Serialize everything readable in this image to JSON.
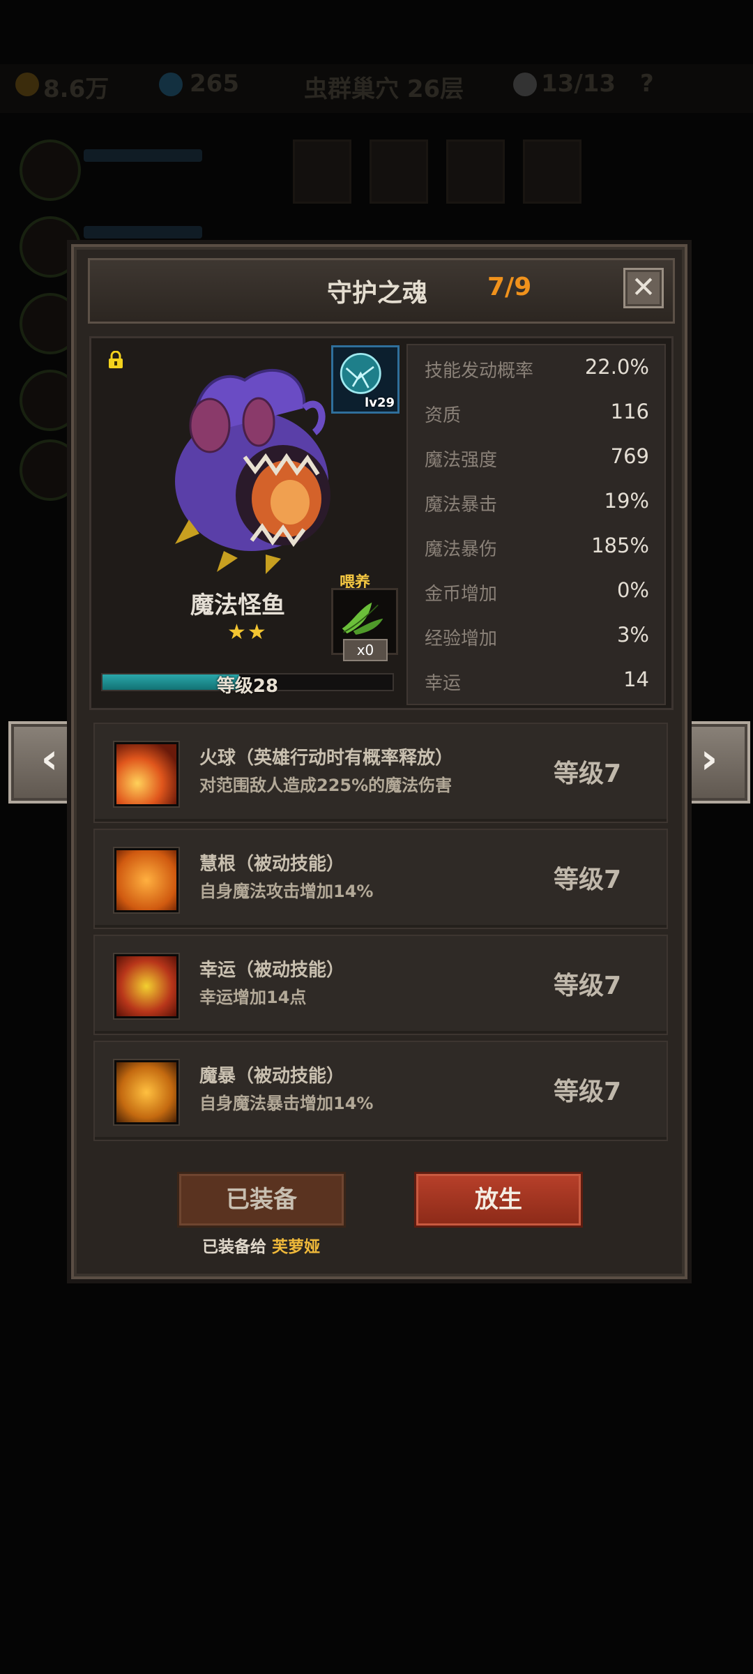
{
  "hud": {
    "gold": "8.6万",
    "gems": "265",
    "stage": "虫群巢穴 26层",
    "kills": "13/13",
    "help": "?"
  },
  "dialog": {
    "title": "守护之魂",
    "count": "7/9",
    "close": "✕"
  },
  "pet": {
    "name": "魔法怪鱼",
    "stars": "★★",
    "star_count": 2,
    "gem_level": "lv29",
    "feed_label": "喂养",
    "feed_count": "x0",
    "level_text": "等级28",
    "level_progress": 0.47
  },
  "stats": [
    {
      "label": "技能发动概率",
      "value": "22.0%"
    },
    {
      "label": "资质",
      "value": "116"
    },
    {
      "label": "魔法强度",
      "value": "769"
    },
    {
      "label": "魔法暴击",
      "value": "19%"
    },
    {
      "label": "魔法暴伤",
      "value": "185%"
    },
    {
      "label": "金币增加",
      "value": "0%"
    },
    {
      "label": "经验增加",
      "value": "3%"
    },
    {
      "label": "幸运",
      "value": "14"
    }
  ],
  "skills": [
    {
      "name": "火球（英雄行动时有概率释放）",
      "desc": "对范围敌人造成225%的魔法伤害",
      "level": "等级7",
      "icon": "fireball-icon"
    },
    {
      "name": "慧根（被动技能）",
      "desc": "自身魔法攻击增加14%",
      "level": "等级7",
      "icon": "demon-icon"
    },
    {
      "name": "幸运（被动技能）",
      "desc": "幸运增加14点",
      "level": "等级7",
      "icon": "puzzle-icon"
    },
    {
      "name": "魔暴（被动技能）",
      "desc": "自身魔法暴击增加14%",
      "level": "等级7",
      "icon": "swirl-icon"
    }
  ],
  "buttons": {
    "equipped": "已装备",
    "release": "放生",
    "equipped_to_prefix": "已装备给",
    "equipped_to_hero": "芙萝娅"
  },
  "nav": {
    "prev": "‹",
    "next": "›"
  },
  "colors": {
    "accent_orange": "#f0921c",
    "gold": "#f5c842",
    "release_red": "#b8402a"
  }
}
